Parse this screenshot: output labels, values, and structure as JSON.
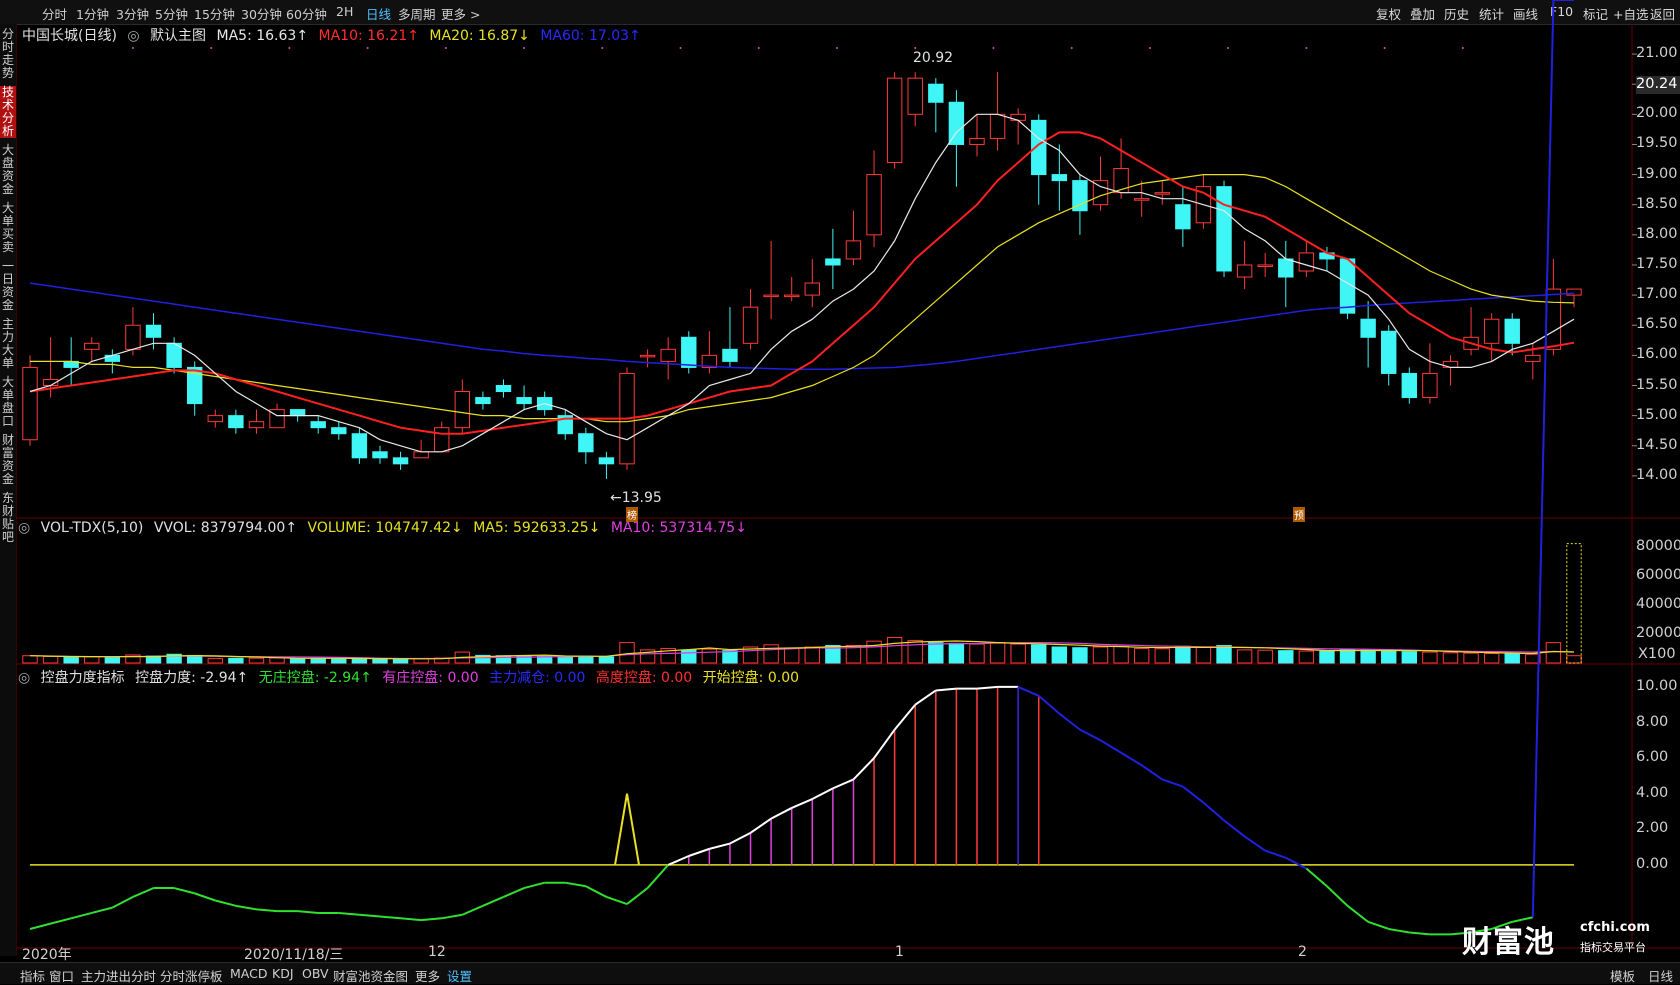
{
  "toolbar": {
    "periods": [
      "分时",
      "1分钟",
      "3分钟",
      "5分钟",
      "15分钟",
      "30分钟",
      "60分钟",
      "2H",
      "日线",
      "多周期",
      "更多 >"
    ],
    "active_period": "日线",
    "right_tools": [
      "复权",
      "叠加",
      "历史",
      "统计",
      "画线",
      "F10",
      "标记",
      "+自选",
      "返回"
    ]
  },
  "left_tabs": [
    "分时走势",
    "技术分析",
    "大盘资金",
    "大单买卖",
    "一日资金",
    "主力大单",
    "大单盘口",
    "财富资金",
    "东财贴吧"
  ],
  "left_tab_active": "技术分析",
  "main_legend": {
    "name": "中国长城(日线)",
    "theme": "默认主图",
    "ma5": "MA5: 16.63↑",
    "ma10": "MA10: 16.21↑",
    "ma20": "MA20: 16.87↓",
    "ma60": "MA60: 17.03↑"
  },
  "vol_legend": {
    "name": "VOL-TDX(5,10)",
    "vvol": "VVOL: 8379794.00↑",
    "volume": "VOLUME: 104747.42↓",
    "ma5": "MA5: 592633.25↓",
    "ma10": "MA10: 537314.75↓"
  },
  "ind_legend": {
    "name": "控盘力度指标",
    "kp": "控盘力度: -2.94↑",
    "wz": "无庄控盘: -2.94↑",
    "yz": "有庄控盘: 0.00",
    "zl": "主力减仓: 0.00",
    "gd": "高度控盘: 0.00",
    "ks": "开始控盘: 0.00"
  },
  "annotations": {
    "high": "20.92",
    "low": "←13.95",
    "current_price": "20.24",
    "tag1": "榜",
    "tag2": "预",
    "vol_unit": "X100"
  },
  "date_axis": [
    "2020年",
    "2020/11/18/三",
    "12",
    "1",
    "2"
  ],
  "bottom_tabs": [
    "指标",
    "窗口",
    "主力进出分时",
    "分时涨停板",
    "MACD",
    "KDJ",
    "OBV",
    "财富池资金图",
    "更多",
    "设置"
  ],
  "bottom_right": [
    "模板",
    "日线"
  ],
  "watermark": {
    "brand": "财富池",
    "domain": "cfchi.com",
    "tagline": "指标交易平台"
  },
  "colors": {
    "up": "#ff3a3a",
    "down": "#3ff5f5",
    "ma5": "#e8e8e8",
    "ma10": "#ff2020",
    "ma20": "#e8e020",
    "ma60": "#2020e0"
  },
  "chart_data": [
    {
      "type": "candlestick",
      "title": "中国长城(日线)",
      "ylim": [
        13.6,
        21.2
      ],
      "y_ticks": [
        14.0,
        14.5,
        15.0,
        15.5,
        16.0,
        16.5,
        17.0,
        17.5,
        18.0,
        18.5,
        19.0,
        19.5,
        20.0,
        20.5,
        21.0
      ],
      "candles": [
        [
          14.6,
          15.8,
          16.0,
          14.5
        ],
        [
          15.5,
          15.6,
          16.3,
          15.3
        ],
        [
          15.9,
          15.8,
          16.3,
          15.5
        ],
        [
          16.1,
          16.2,
          16.3,
          15.9
        ],
        [
          16.0,
          15.9,
          16.1,
          15.7
        ],
        [
          16.1,
          16.5,
          16.8,
          16.0
        ],
        [
          16.5,
          16.3,
          16.7,
          16.1
        ],
        [
          16.2,
          15.8,
          16.3,
          15.7
        ],
        [
          15.8,
          15.2,
          15.9,
          15.0
        ],
        [
          14.9,
          15.0,
          15.1,
          14.8
        ],
        [
          15.0,
          14.8,
          15.1,
          14.7
        ],
        [
          14.8,
          14.9,
          15.1,
          14.7
        ],
        [
          14.8,
          15.1,
          15.2,
          14.8
        ],
        [
          15.1,
          15.0,
          15.1,
          14.9
        ],
        [
          14.9,
          14.8,
          15.0,
          14.7
        ],
        [
          14.8,
          14.7,
          14.9,
          14.6
        ],
        [
          14.7,
          14.3,
          14.8,
          14.2
        ],
        [
          14.4,
          14.3,
          14.5,
          14.2
        ],
        [
          14.3,
          14.2,
          14.4,
          14.1
        ],
        [
          14.3,
          14.4,
          14.6,
          14.3
        ],
        [
          14.4,
          14.8,
          14.9,
          14.4
        ],
        [
          14.8,
          15.4,
          15.6,
          14.7
        ],
        [
          15.3,
          15.2,
          15.4,
          15.1
        ],
        [
          15.5,
          15.4,
          15.6,
          15.3
        ],
        [
          15.3,
          15.2,
          15.5,
          15.1
        ],
        [
          15.3,
          15.1,
          15.4,
          15.0
        ],
        [
          15.0,
          14.7,
          15.1,
          14.6
        ],
        [
          14.7,
          14.4,
          14.8,
          14.2
        ],
        [
          14.3,
          14.2,
          14.4,
          13.95
        ],
        [
          14.2,
          15.7,
          15.8,
          14.1
        ],
        [
          16.0,
          16.0,
          16.1,
          15.8
        ],
        [
          15.9,
          16.1,
          16.3,
          15.6
        ],
        [
          16.3,
          15.8,
          16.4,
          15.7
        ],
        [
          15.8,
          16.0,
          16.4,
          15.7
        ],
        [
          16.1,
          15.9,
          16.8,
          15.8
        ],
        [
          16.2,
          16.8,
          17.1,
          16.1
        ],
        [
          17.0,
          17.0,
          17.9,
          16.6
        ],
        [
          17.0,
          17.0,
          17.3,
          16.9
        ],
        [
          17.0,
          17.2,
          17.6,
          16.8
        ],
        [
          17.6,
          17.5,
          18.1,
          17.1
        ],
        [
          17.6,
          17.9,
          18.4,
          17.5
        ],
        [
          18.0,
          19.0,
          19.4,
          17.8
        ],
        [
          19.2,
          20.6,
          20.7,
          19.1
        ],
        [
          20.0,
          20.6,
          20.7,
          19.8
        ],
        [
          20.5,
          20.2,
          20.6,
          19.7
        ],
        [
          20.2,
          19.5,
          20.4,
          18.8
        ],
        [
          19.5,
          19.6,
          20.0,
          19.3
        ],
        [
          19.6,
          20.0,
          20.7,
          19.4
        ],
        [
          19.9,
          20.0,
          20.1,
          19.5
        ],
        [
          19.9,
          19.0,
          20.0,
          18.5
        ],
        [
          19.0,
          18.9,
          19.5,
          18.4
        ],
        [
          18.9,
          18.4,
          19.0,
          18.0
        ],
        [
          18.5,
          18.9,
          19.3,
          18.4
        ],
        [
          18.7,
          19.1,
          19.6,
          18.6
        ],
        [
          18.6,
          18.6,
          18.9,
          18.3
        ],
        [
          18.7,
          18.7,
          18.9,
          18.5
        ],
        [
          18.5,
          18.1,
          18.8,
          17.8
        ],
        [
          18.2,
          18.8,
          19.0,
          18.1
        ],
        [
          18.8,
          17.4,
          18.9,
          17.3
        ],
        [
          17.3,
          17.5,
          17.9,
          17.1
        ],
        [
          17.5,
          17.5,
          17.7,
          17.3
        ],
        [
          17.6,
          17.3,
          17.9,
          16.8
        ],
        [
          17.4,
          17.7,
          17.9,
          17.3
        ],
        [
          17.7,
          17.6,
          17.8,
          17.4
        ],
        [
          17.6,
          16.7,
          17.6,
          16.6
        ],
        [
          16.6,
          16.3,
          16.9,
          15.8
        ],
        [
          16.4,
          15.7,
          16.5,
          15.5
        ],
        [
          15.7,
          15.3,
          15.8,
          15.2
        ],
        [
          15.3,
          15.7,
          16.2,
          15.2
        ],
        [
          15.8,
          15.9,
          16.0,
          15.5
        ],
        [
          16.1,
          16.3,
          16.8,
          16.0
        ],
        [
          16.2,
          16.6,
          16.7,
          15.9
        ],
        [
          16.6,
          16.2,
          16.7,
          16.0
        ],
        [
          15.9,
          16.0,
          16.2,
          15.6
        ],
        [
          16.1,
          17.1,
          17.6,
          16.0
        ],
        [
          17.0,
          17.1,
          17.1,
          16.8
        ]
      ],
      "ma5": [
        15.4,
        15.5,
        15.7,
        15.9,
        16.0,
        16.1,
        16.2,
        16.2,
        16.0,
        15.7,
        15.4,
        15.2,
        15.0,
        15.0,
        15.0,
        14.9,
        14.8,
        14.6,
        14.5,
        14.4,
        14.4,
        14.5,
        14.7,
        14.9,
        15.1,
        15.2,
        15.1,
        14.9,
        14.7,
        14.6,
        14.8,
        15.0,
        15.2,
        15.5,
        15.6,
        15.7,
        16.1,
        16.4,
        16.6,
        16.9,
        17.1,
        17.4,
        17.9,
        18.6,
        19.2,
        19.7,
        20.0,
        20.0,
        19.9,
        19.6,
        19.4,
        19.0,
        18.8,
        18.7,
        18.7,
        18.6,
        18.6,
        18.5,
        18.4,
        18.1,
        17.9,
        17.6,
        17.5,
        17.4,
        17.2,
        17.0,
        16.6,
        16.1,
        15.9,
        15.8,
        15.8,
        15.9,
        16.1,
        16.2,
        16.4,
        16.6
      ],
      "ma10": [
        15.4,
        15.45,
        15.5,
        15.55,
        15.6,
        15.65,
        15.7,
        15.75,
        15.75,
        15.7,
        15.6,
        15.5,
        15.4,
        15.3,
        15.2,
        15.1,
        15.0,
        14.9,
        14.8,
        14.75,
        14.7,
        14.7,
        14.75,
        14.8,
        14.85,
        14.9,
        14.95,
        14.95,
        14.95,
        14.95,
        15.0,
        15.1,
        15.2,
        15.3,
        15.4,
        15.45,
        15.5,
        15.7,
        15.9,
        16.2,
        16.5,
        16.8,
        17.2,
        17.6,
        17.9,
        18.2,
        18.5,
        18.9,
        19.2,
        19.5,
        19.7,
        19.7,
        19.6,
        19.4,
        19.2,
        19.0,
        18.8,
        18.7,
        18.5,
        18.4,
        18.3,
        18.1,
        17.9,
        17.7,
        17.6,
        17.3,
        17.0,
        16.7,
        16.5,
        16.3,
        16.2,
        16.1,
        16.05,
        16.1,
        16.15,
        16.21
      ],
      "ma20": [
        15.9,
        15.9,
        15.9,
        15.85,
        15.85,
        15.8,
        15.8,
        15.75,
        15.7,
        15.65,
        15.6,
        15.55,
        15.5,
        15.45,
        15.4,
        15.35,
        15.3,
        15.25,
        15.2,
        15.15,
        15.1,
        15.05,
        15.0,
        15.0,
        14.95,
        14.95,
        14.95,
        14.95,
        14.9,
        14.9,
        14.95,
        15.0,
        15.1,
        15.15,
        15.2,
        15.25,
        15.3,
        15.4,
        15.5,
        15.65,
        15.8,
        16.0,
        16.3,
        16.6,
        16.9,
        17.2,
        17.5,
        17.8,
        18.0,
        18.2,
        18.35,
        18.5,
        18.65,
        18.75,
        18.85,
        18.9,
        18.95,
        19.0,
        19.0,
        19.0,
        18.95,
        18.8,
        18.6,
        18.4,
        18.2,
        18.0,
        17.8,
        17.6,
        17.4,
        17.25,
        17.1,
        17.0,
        16.95,
        16.9,
        16.88,
        16.87
      ],
      "ma60": [
        17.2,
        17.15,
        17.1,
        17.05,
        17.0,
        16.95,
        16.9,
        16.85,
        16.8,
        16.75,
        16.7,
        16.65,
        16.6,
        16.55,
        16.5,
        16.45,
        16.4,
        16.35,
        16.3,
        16.25,
        16.2,
        16.15,
        16.1,
        16.07,
        16.03,
        16.0,
        15.98,
        15.95,
        15.93,
        15.9,
        15.88,
        15.86,
        15.84,
        15.82,
        15.8,
        15.79,
        15.78,
        15.77,
        15.77,
        15.77,
        15.78,
        15.79,
        15.8,
        15.83,
        15.86,
        15.9,
        15.95,
        16.0,
        16.05,
        16.1,
        16.15,
        16.2,
        16.25,
        16.3,
        16.35,
        16.4,
        16.45,
        16.5,
        16.55,
        16.6,
        16.65,
        16.7,
        16.75,
        16.78,
        16.8,
        16.83,
        16.85,
        16.87,
        16.89,
        16.91,
        16.93,
        16.95,
        16.97,
        16.99,
        17.01,
        17.03
      ]
    },
    {
      "type": "bar",
      "title": "VOL-TDX(5,10)",
      "ylim": [
        0,
        90000
      ],
      "y_ticks": [
        20000,
        40000,
        60000,
        80000
      ],
      "volumes": [
        5000,
        4500,
        4000,
        4200,
        3800,
        5500,
        4800,
        6000,
        5200,
        3000,
        3200,
        3300,
        3500,
        3100,
        3200,
        3000,
        2900,
        2800,
        2700,
        3000,
        3400,
        7500,
        5200,
        5000,
        4800,
        4600,
        4400,
        4700,
        4200,
        14000,
        9000,
        10000,
        9000,
        9500,
        8500,
        11000,
        12500,
        10000,
        11000,
        12000,
        12000,
        15000,
        17500,
        15500,
        14000,
        13500,
        13000,
        14000,
        13000,
        12500,
        11000,
        10500,
        11000,
        11500,
        10000,
        9800,
        11500,
        10800,
        12000,
        9000,
        8800,
        8500,
        8200,
        8000,
        9500,
        8800,
        8500,
        7800,
        7500,
        7000,
        6800,
        6500,
        6200,
        6000,
        14000,
        5000
      ],
      "ghost_bar": 82000
    },
    {
      "type": "area",
      "title": "控盘力度指标",
      "ylim": [
        -4.5,
        10.5
      ],
      "y_ticks": [
        0,
        2,
        4,
        6,
        8,
        10
      ],
      "values": [
        -3.6,
        -3.3,
        -3.0,
        -2.7,
        -2.4,
        -1.8,
        -1.3,
        -1.3,
        -1.6,
        -2.0,
        -2.3,
        -2.5,
        -2.6,
        -2.6,
        -2.7,
        -2.7,
        -2.8,
        -2.9,
        -3.0,
        -3.1,
        -3.0,
        -2.8,
        -2.3,
        -1.8,
        -1.3,
        -1.0,
        -1.0,
        -1.2,
        -1.8,
        -2.2,
        -1.3,
        0.0,
        0.5,
        0.9,
        1.2,
        1.8,
        2.6,
        3.2,
        3.7,
        4.3,
        4.8,
        6.0,
        7.6,
        9.0,
        9.8,
        9.9,
        9.9,
        10.0,
        10.0,
        9.5,
        8.5,
        7.6,
        7.0,
        6.3,
        5.6,
        4.8,
        4.4,
        3.5,
        2.5,
        1.6,
        0.8,
        0.4,
        -0.2,
        -1.2,
        -2.3,
        -3.2,
        -3.6,
        -3.8,
        -3.9,
        -3.9,
        -3.8,
        -3.6,
        -3.2,
        -2.94
      ]
    }
  ]
}
